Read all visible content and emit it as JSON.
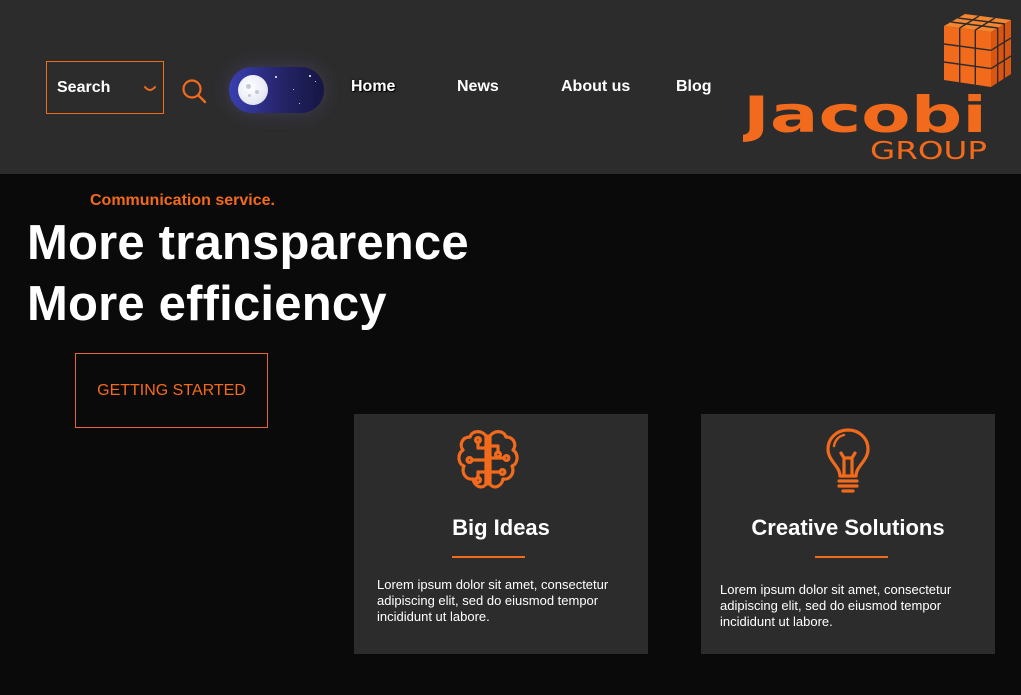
{
  "colors": {
    "accent": "#f26a1b",
    "header_bg": "#2d2c2d",
    "page_bg": "#0b0a0b",
    "card_bg": "#2d2c2d"
  },
  "header": {
    "search": {
      "label": "Search",
      "dropdown_icon": "chevron-down-icon",
      "button_icon": "search-icon"
    },
    "theme_toggle": {
      "state": "night",
      "icon": "moon-icon"
    },
    "nav": {
      "home": "Home",
      "news": "News",
      "about": "About us",
      "blog": "Blog"
    },
    "logo": {
      "wordmark": "Jacobi",
      "sub": "GROUP",
      "icon": "cube-icon"
    }
  },
  "hero": {
    "eyebrow": "Communication service.",
    "line1": "More transparence",
    "line2": "More efficiency",
    "cta": "GETTING STARTED"
  },
  "cards": [
    {
      "icon": "brain-icon",
      "title": "Big Ideas",
      "body": "Lorem ipsum dolor sit amet, consectetur adipiscing elit, sed do eiusmod tempor incididunt ut labore."
    },
    {
      "icon": "lightbulb-icon",
      "title": "Creative Solutions",
      "body": "Lorem ipsum dolor sit amet, consectetur adipiscing elit, sed do eiusmod tempor incididunt ut labore."
    }
  ]
}
